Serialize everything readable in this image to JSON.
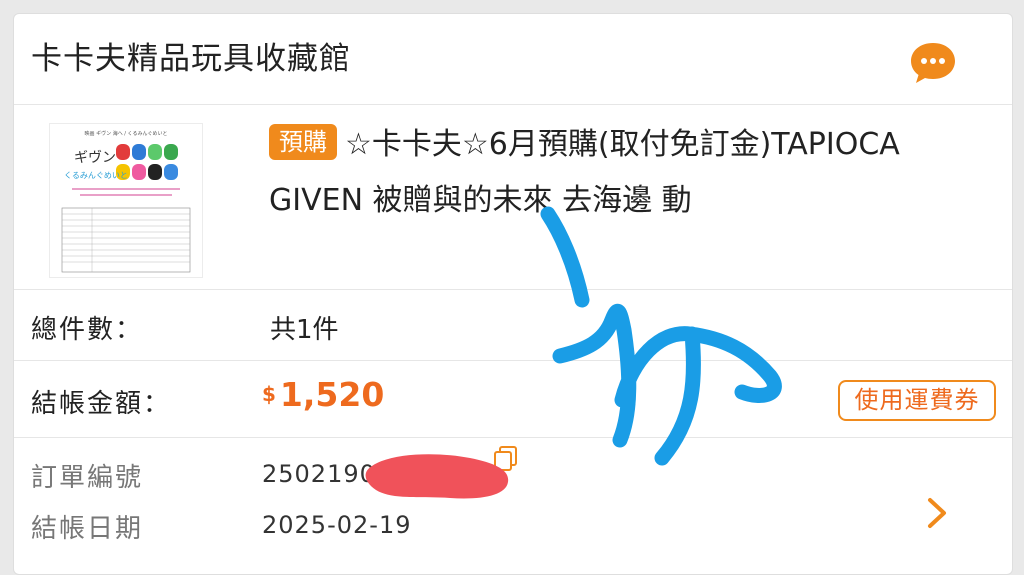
{
  "shop": {
    "name": "卡卡夫精品玩具收藏館",
    "chat_icon": "chat-bubble-icon",
    "accent_color": "#f08a1c"
  },
  "product": {
    "badge": "預購",
    "title": "☆卡卡夫☆6月預購(取付免訂金)TAPIOCA GIVEN 被贈與的未來 去海邊 動",
    "thumbnail": {
      "heading": "映画 ギヴン 海へ / くるみんぐめいと",
      "logo": "ギヴン",
      "sublogo": "くるみんぐめいと"
    }
  },
  "summary": {
    "total_items_label": "總件數：",
    "total_items_value": "共1件",
    "total_amount_label": "結帳金額：",
    "currency": "$",
    "total_amount_value": "1,520",
    "coupon_button": "使用運費券"
  },
  "order": {
    "number_label": "訂單編號",
    "number_value": "2502190",
    "date_label": "結帳日期",
    "date_value": "2025-02-19"
  }
}
